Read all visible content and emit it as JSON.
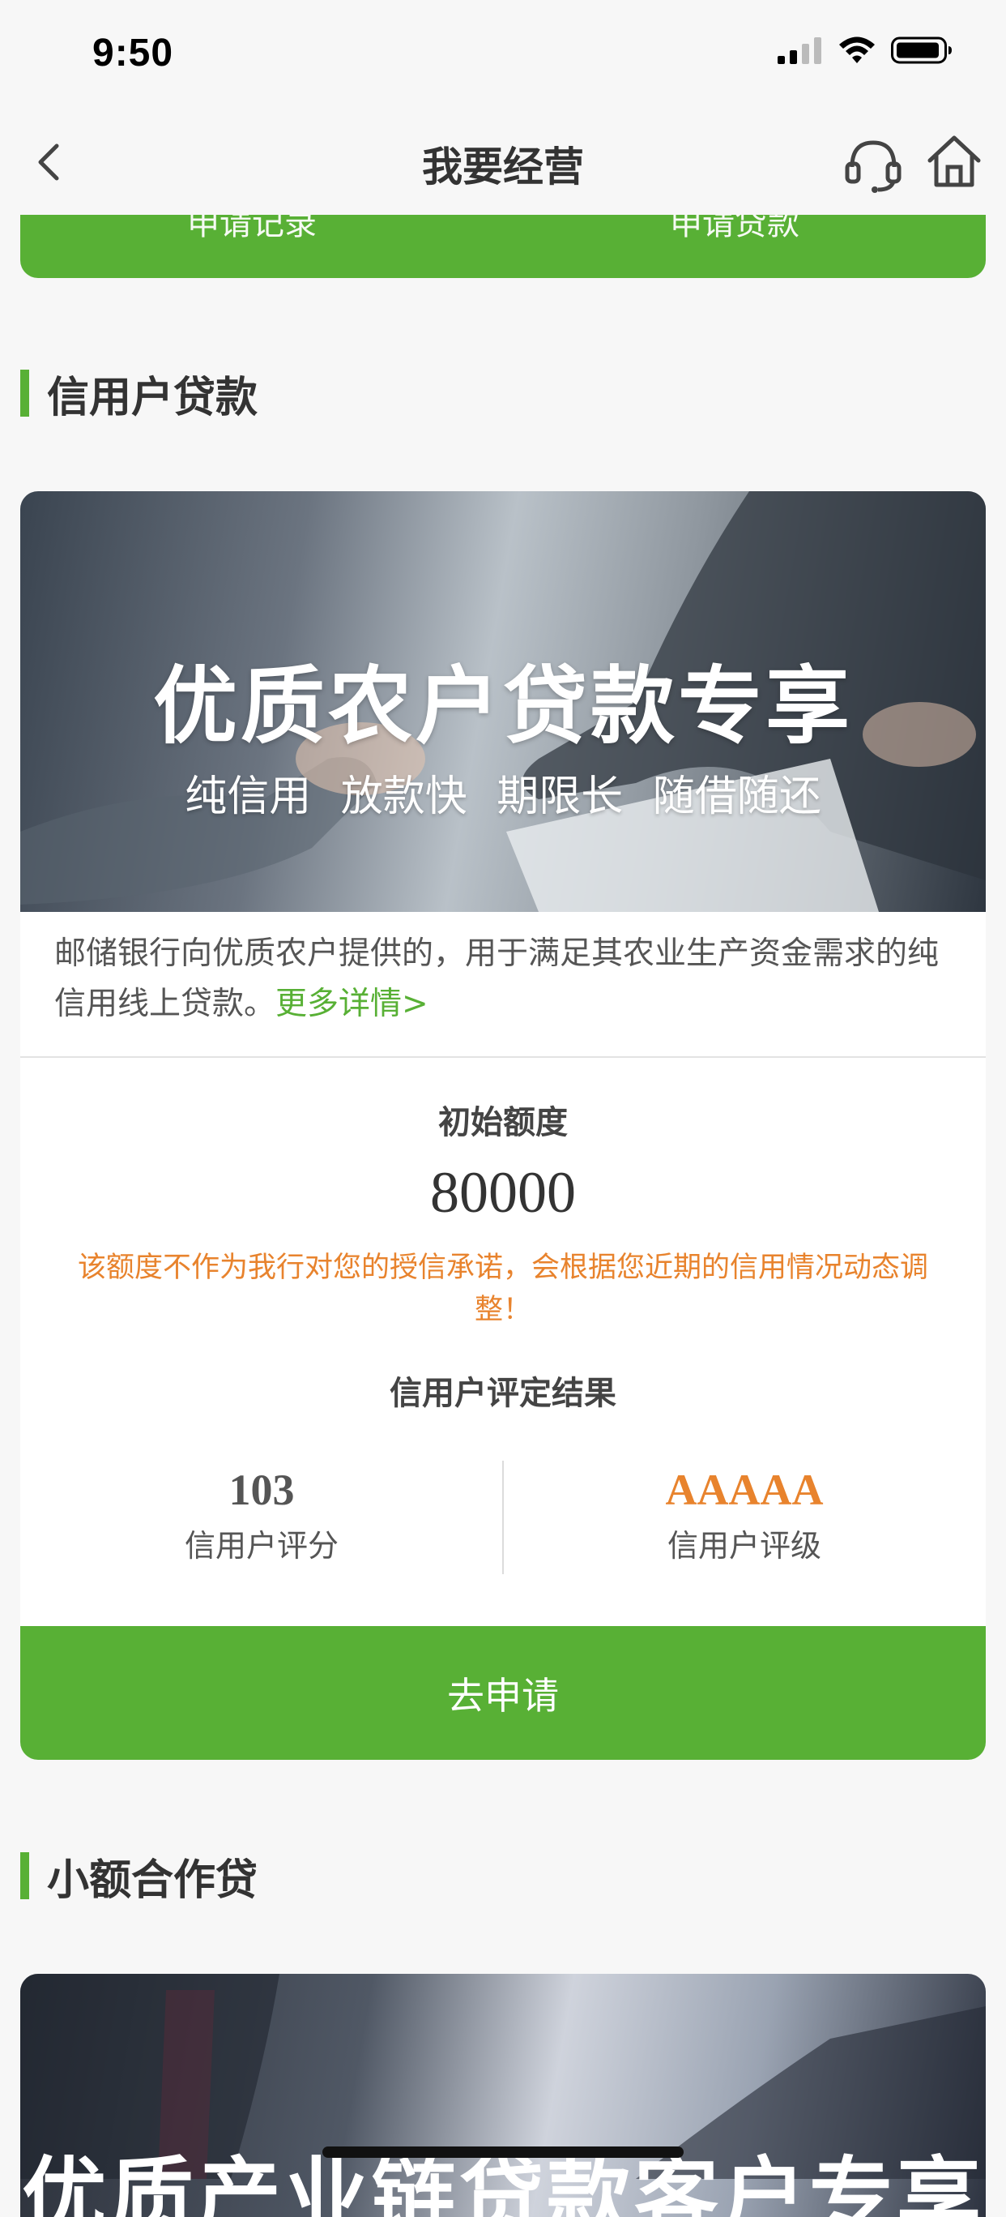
{
  "status_bar": {
    "time": "9:50"
  },
  "navbar": {
    "title": "我要经营"
  },
  "top_buttons": {
    "left": "申请记录",
    "right": "申请贷款"
  },
  "credit_section": {
    "title": "信用户贷款",
    "banner_title": "优质农户贷款专享",
    "banner_subtitle": "纯信用 放款快 期限长 随借随还",
    "description": "邮储银行向优质农户提供的，用于满足其农业生产资金需求的纯信用线上贷款。",
    "more_link": "更多详情>",
    "limit_label": "初始额度",
    "limit_value": "80000",
    "notice": "该额度不作为我行对您的授信承诺，会根据您近期的信用情况动态调整！",
    "result_label": "信用户评定结果",
    "score_value": "103",
    "score_label": "信用户评分",
    "rating_value": "AAAAA",
    "rating_label": "信用户评级",
    "apply_button": "去申请"
  },
  "small_loan_section": {
    "title": "小额合作贷",
    "banner_title": "优质产业链贷款客户专享"
  },
  "colors": {
    "brand_green": "#58b035",
    "notice_orange": "#e8832d",
    "score_gray": "#555555",
    "rating_orange": "#e8832d"
  },
  "icons": {
    "back": "chevron-left-icon",
    "customer_service": "headset-icon",
    "home": "home-icon",
    "signal": "signal-icon",
    "wifi": "wifi-icon",
    "battery": "battery-icon"
  }
}
